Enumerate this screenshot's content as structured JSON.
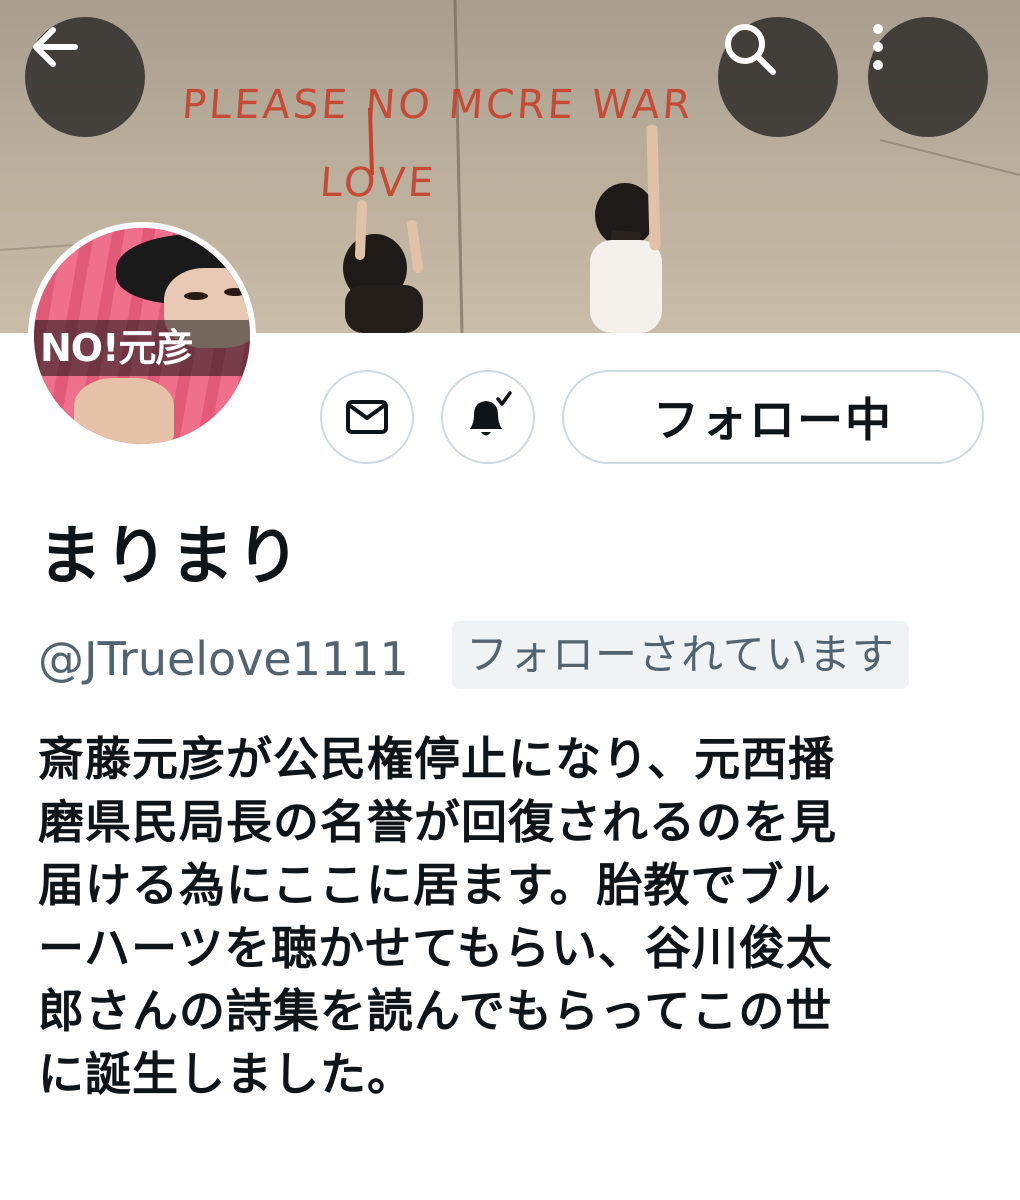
{
  "header": {
    "banner_text_line1": "PLEASE NO MCRE WAR",
    "banner_text_line2": "LOVE"
  },
  "avatar": {
    "label": "NO!元彦"
  },
  "actions": {
    "follow_label": "フォロー中",
    "icons": [
      "back-arrow-icon",
      "search-icon",
      "more-vertical-icon",
      "mail-icon",
      "bell-check-icon"
    ]
  },
  "profile": {
    "display_name": "まりまり",
    "handle": "@JTruelove1111",
    "follows_you": "フォローされています",
    "bio_lines": [
      "斎藤元彦が公民権停止になり、元西播",
      "磨県民局長の名誉が回復されるのを見",
      "届ける為にここに居ます。胎教でブル",
      "ーハーツを聴かせてもらい、谷川俊太",
      "郎さんの詩集を読んでもらってこの世",
      "に誕生しました。"
    ]
  },
  "colors": {
    "graffiti": "#c8412c",
    "secondary_text": "#536471",
    "border": "#cfd9de"
  }
}
